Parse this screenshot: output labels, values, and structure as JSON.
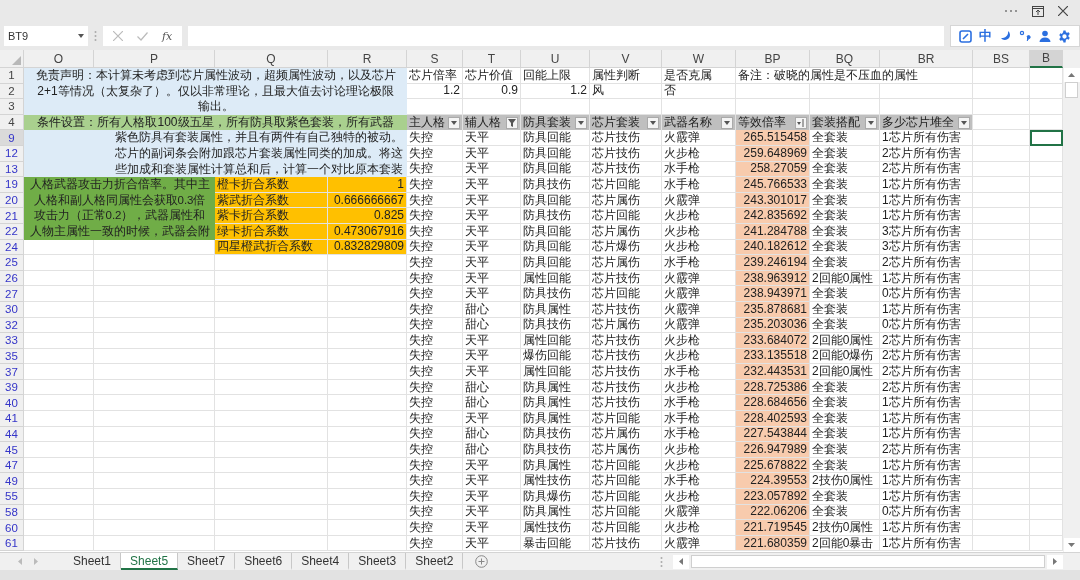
{
  "formula_bar": {
    "name_box": "BT9",
    "function_label": "fx"
  },
  "ime_toolbar": {
    "mode": "中"
  },
  "columns": [
    {
      "label": "O",
      "selected": false
    },
    {
      "label": "P",
      "selected": false
    },
    {
      "label": "Q",
      "selected": false
    },
    {
      "label": "R",
      "selected": false
    },
    {
      "label": "S",
      "selected": false
    },
    {
      "label": "T",
      "selected": false
    },
    {
      "label": "U",
      "selected": false
    },
    {
      "label": "V",
      "selected": false
    },
    {
      "label": "W",
      "selected": false
    },
    {
      "label": "BP",
      "selected": false
    },
    {
      "label": "BQ",
      "selected": false
    },
    {
      "label": "BR",
      "selected": false
    },
    {
      "label": "BS",
      "selected": false
    },
    {
      "label": "B",
      "selected": true
    }
  ],
  "row_numbers": [
    {
      "label": "1",
      "filtered": false,
      "selected": false
    },
    {
      "label": "2",
      "filtered": false,
      "selected": false
    },
    {
      "label": "3",
      "filtered": false,
      "selected": false
    },
    {
      "label": "4",
      "filtered": false,
      "selected": false
    },
    {
      "label": "9",
      "filtered": true,
      "selected": true
    },
    {
      "label": "12",
      "filtered": true,
      "selected": false
    },
    {
      "label": "13",
      "filtered": true,
      "selected": false
    },
    {
      "label": "19",
      "filtered": true,
      "selected": false
    },
    {
      "label": "20",
      "filtered": true,
      "selected": false
    },
    {
      "label": "21",
      "filtered": true,
      "selected": false
    },
    {
      "label": "22",
      "filtered": true,
      "selected": false
    },
    {
      "label": "24",
      "filtered": true,
      "selected": false
    },
    {
      "label": "25",
      "filtered": true,
      "selected": false
    },
    {
      "label": "26",
      "filtered": true,
      "selected": false
    },
    {
      "label": "27",
      "filtered": true,
      "selected": false
    },
    {
      "label": "30",
      "filtered": true,
      "selected": false
    },
    {
      "label": "32",
      "filtered": true,
      "selected": false
    },
    {
      "label": "33",
      "filtered": true,
      "selected": false
    },
    {
      "label": "35",
      "filtered": true,
      "selected": false
    },
    {
      "label": "37",
      "filtered": true,
      "selected": false
    },
    {
      "label": "39",
      "filtered": true,
      "selected": false
    },
    {
      "label": "40",
      "filtered": true,
      "selected": false
    },
    {
      "label": "41",
      "filtered": true,
      "selected": false
    },
    {
      "label": "44",
      "filtered": true,
      "selected": false
    },
    {
      "label": "45",
      "filtered": true,
      "selected": false
    },
    {
      "label": "47",
      "filtered": true,
      "selected": false
    },
    {
      "label": "49",
      "filtered": true,
      "selected": false
    },
    {
      "label": "55",
      "filtered": true,
      "selected": false
    },
    {
      "label": "58",
      "filtered": true,
      "selected": false
    },
    {
      "label": "60",
      "filtered": true,
      "selected": false
    },
    {
      "label": "61",
      "filtered": true,
      "selected": false
    }
  ],
  "disclaimer": {
    "lines": [
      "免责声明：本计算未考虑到芯片属性波动，超频属性波动，以及芯片",
      "2+1等情况（太复杂了）。仅以非常理论，且最大值去讨论理论极限",
      "输出。"
    ]
  },
  "conditions": {
    "heading": "条件设置：所有人格取100级五星，所有防具取紫色套装，所有武器",
    "lines": [
      "紫色防具有套装属性，并且有两件有自己独特的被动。",
      "芯片的副词条会附加跟芯片套装属性同类的加成。将这",
      "些加成和套装属性计算总和后，计算一个对比原本套装"
    ]
  },
  "weapon_note": {
    "lines": [
      "人格武器攻击力折合倍率。其中主",
      "人格和副人格同属性会获取0.3倍",
      "攻击力（正常0.2），武器属性和",
      "人物主属性一致的时候，武器会附"
    ]
  },
  "coefficients": [
    {
      "label": "橙卡折合系数",
      "value": "1"
    },
    {
      "label": "紫武折合系数",
      "value": "0.666666667"
    },
    {
      "label": "紫卡折合系数",
      "value": "0.825"
    },
    {
      "label": "绿卡折合系数",
      "value": "0.473067916"
    },
    {
      "label": "四星橙武折合系数",
      "value": "0.832829809"
    }
  ],
  "parameters": [
    {
      "label": "芯片倍率",
      "value": "1.2",
      "kind": "number"
    },
    {
      "label": "芯片价值",
      "value": "0.9",
      "kind": "number"
    },
    {
      "label": "回能上限",
      "value": "1.2",
      "kind": "number"
    },
    {
      "label": "属性判断",
      "value": "风",
      "kind": "text"
    },
    {
      "label": "是否克属",
      "value": "否",
      "kind": "text"
    }
  ],
  "remark": "备注：破晓的属性是不压血的属性",
  "table": {
    "columns": [
      {
        "label": "主人格",
        "kind": "dropdown",
        "numeric": false,
        "highlighted": false
      },
      {
        "label": "辅人格",
        "kind": "filtered",
        "numeric": false,
        "highlighted": false
      },
      {
        "label": "防具套装",
        "kind": "dropdown",
        "numeric": false,
        "highlighted": false
      },
      {
        "label": "芯片套装",
        "kind": "dropdown",
        "numeric": false,
        "highlighted": false
      },
      {
        "label": "武器名称",
        "kind": "dropdown",
        "numeric": false,
        "highlighted": false
      },
      {
        "label": "等效倍率",
        "kind": "sorted",
        "numeric": true,
        "highlighted": true
      },
      {
        "label": "套装搭配",
        "kind": "dropdown",
        "numeric": false,
        "highlighted": false
      },
      {
        "label": "多少芯片堆全",
        "kind": "dropdown",
        "numeric": false,
        "highlighted": false
      }
    ],
    "rows": [
      [
        "失控",
        "天平",
        "防具回能",
        "芯片技伤",
        "火霰弹",
        "265.515458",
        "全套装",
        "1芯片所有伤害"
      ],
      [
        "失控",
        "天平",
        "防具回能",
        "芯片技伤",
        "火步枪",
        "259.648969",
        "全套装",
        "2芯片所有伤害"
      ],
      [
        "失控",
        "天平",
        "防具回能",
        "芯片技伤",
        "水手枪",
        "258.27059",
        "全套装",
        "2芯片所有伤害"
      ],
      [
        "失控",
        "天平",
        "防具技伤",
        "芯片回能",
        "水手枪",
        "245.766533",
        "全套装",
        "1芯片所有伤害"
      ],
      [
        "失控",
        "天平",
        "防具回能",
        "芯片属伤",
        "火霰弹",
        "243.301017",
        "全套装",
        "1芯片所有伤害"
      ],
      [
        "失控",
        "天平",
        "防具技伤",
        "芯片回能",
        "火步枪",
        "242.835692",
        "全套装",
        "1芯片所有伤害"
      ],
      [
        "失控",
        "天平",
        "防具回能",
        "芯片属伤",
        "火步枪",
        "241.284788",
        "全套装",
        "3芯片所有伤害"
      ],
      [
        "失控",
        "天平",
        "防具回能",
        "芯片爆伤",
        "火步枪",
        "240.182612",
        "全套装",
        "3芯片所有伤害"
      ],
      [
        "失控",
        "天平",
        "防具回能",
        "芯片属伤",
        "水手枪",
        "239.246194",
        "全套装",
        "2芯片所有伤害"
      ],
      [
        "失控",
        "天平",
        "属性回能",
        "芯片技伤",
        "火霰弹",
        "238.963912",
        "2回能0属性",
        "1芯片所有伤害"
      ],
      [
        "失控",
        "天平",
        "防具技伤",
        "芯片回能",
        "火霰弹",
        "238.943971",
        "全套装",
        "0芯片所有伤害"
      ],
      [
        "失控",
        "甜心",
        "防具属性",
        "芯片技伤",
        "火霰弹",
        "235.878681",
        "全套装",
        "1芯片所有伤害"
      ],
      [
        "失控",
        "甜心",
        "防具技伤",
        "芯片属伤",
        "火霰弹",
        "235.203036",
        "全套装",
        "0芯片所有伤害"
      ],
      [
        "失控",
        "天平",
        "属性回能",
        "芯片技伤",
        "火步枪",
        "233.684072",
        "2回能0属性",
        "2芯片所有伤害"
      ],
      [
        "失控",
        "天平",
        "爆伤回能",
        "芯片技伤",
        "火步枪",
        "233.135518",
        "2回能0爆伤",
        "2芯片所有伤害"
      ],
      [
        "失控",
        "天平",
        "属性回能",
        "芯片技伤",
        "水手枪",
        "232.443531",
        "2回能0属性",
        "2芯片所有伤害"
      ],
      [
        "失控",
        "甜心",
        "防具属性",
        "芯片技伤",
        "火步枪",
        "228.725386",
        "全套装",
        "2芯片所有伤害"
      ],
      [
        "失控",
        "甜心",
        "防具属性",
        "芯片技伤",
        "水手枪",
        "228.684656",
        "全套装",
        "1芯片所有伤害"
      ],
      [
        "失控",
        "天平",
        "防具属性",
        "芯片回能",
        "水手枪",
        "228.402593",
        "全套装",
        "1芯片所有伤害"
      ],
      [
        "失控",
        "甜心",
        "防具技伤",
        "芯片属伤",
        "水手枪",
        "227.543844",
        "全套装",
        "1芯片所有伤害"
      ],
      [
        "失控",
        "甜心",
        "防具技伤",
        "芯片属伤",
        "火步枪",
        "226.947989",
        "全套装",
        "2芯片所有伤害"
      ],
      [
        "失控",
        "天平",
        "防具属性",
        "芯片回能",
        "火步枪",
        "225.678822",
        "全套装",
        "1芯片所有伤害"
      ],
      [
        "失控",
        "天平",
        "属性技伤",
        "芯片回能",
        "水手枪",
        "224.39553",
        "2技伤0属性",
        "1芯片所有伤害"
      ],
      [
        "失控",
        "天平",
        "防具爆伤",
        "芯片回能",
        "火步枪",
        "223.057892",
        "全套装",
        "1芯片所有伤害"
      ],
      [
        "失控",
        "天平",
        "防具属性",
        "芯片回能",
        "火霰弹",
        "222.06206",
        "全套装",
        "0芯片所有伤害"
      ],
      [
        "失控",
        "天平",
        "属性技伤",
        "芯片回能",
        "火步枪",
        "221.719545",
        "2技伤0属性",
        "1芯片所有伤害"
      ],
      [
        "失控",
        "天平",
        "暴击回能",
        "芯片技伤",
        "火霰弹",
        "221.680359",
        "2回能0暴击",
        "1芯片所有伤害"
      ]
    ]
  },
  "sheet_tabs": [
    {
      "label": "Sheet1",
      "selected": false
    },
    {
      "label": "Sheet5",
      "selected": true
    },
    {
      "label": "Sheet7",
      "selected": false
    },
    {
      "label": "Sheet6",
      "selected": false
    },
    {
      "label": "Sheet4",
      "selected": false
    },
    {
      "label": "Sheet3",
      "selected": false
    },
    {
      "label": "Sheet2",
      "selected": false
    }
  ]
}
